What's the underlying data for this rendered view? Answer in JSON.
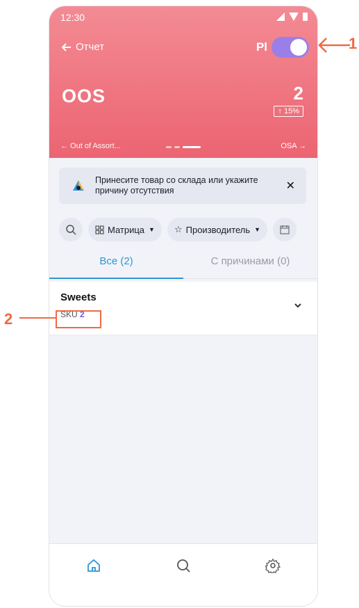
{
  "status_bar": {
    "time": "12:30"
  },
  "header": {
    "back_label": "Отчет",
    "pl_label": "Pl",
    "metric_name": "OOS",
    "metric_value": "2",
    "delta": "↑ 15%",
    "prev_label": "← Out of Assort...",
    "next_label": "OSA →",
    "accent_color": "#ec6472"
  },
  "banner": {
    "text": "Принесите товар со склада или укажите причину отсутствия",
    "close": "✕"
  },
  "filters": {
    "matrix_label": "Матрица",
    "producer_label": "Производитель"
  },
  "tabs": [
    {
      "label": "Все (2)"
    },
    {
      "label": "С причинами (0)"
    }
  ],
  "list": [
    {
      "title": "Sweets",
      "sku_label": "SKU",
      "sku_count": "2"
    }
  ],
  "annotations": {
    "one": "1",
    "two": "2"
  }
}
